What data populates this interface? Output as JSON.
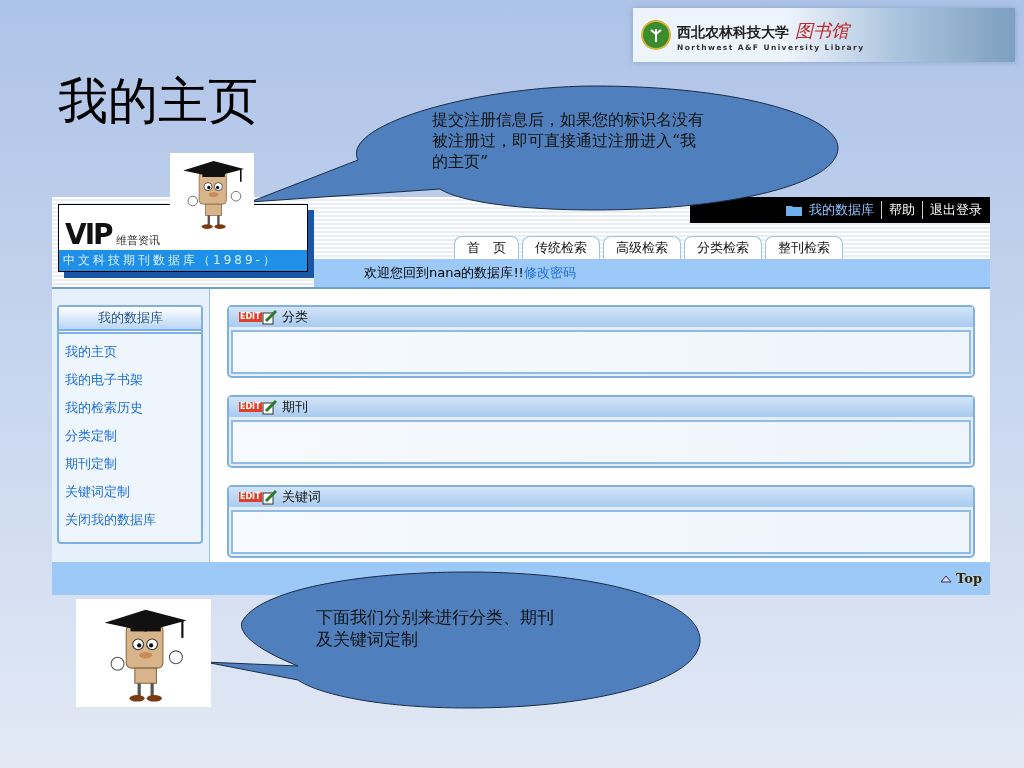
{
  "banner": {
    "name": "西北农林科技大学",
    "script_name": "图书馆",
    "subtitle": "Northwest A&F University Library"
  },
  "title": "我的主页",
  "site": {
    "logo_mark": "VIP",
    "logo_brand": "维普资讯",
    "logo_caption": "中文科技期刊数据库（1989-）",
    "top_links": [
      "我的数据库",
      "帮助",
      "退出登录"
    ],
    "tabs": [
      {
        "label": "首　页",
        "selected": false
      },
      {
        "label": "传统检索",
        "selected": false
      },
      {
        "label": "高级检索",
        "selected": false
      },
      {
        "label": "分类检索",
        "selected": false
      },
      {
        "label": "整刊检索",
        "selected": false
      }
    ],
    "welcome": "欢迎您回到nana的数据库!!",
    "welcome_link": "修改密码",
    "sidebar": {
      "title": "我的数据库",
      "items": [
        "我的主页",
        "我的电子书架",
        "我的检索历史",
        "分类定制",
        "期刊定制",
        "关键词定制",
        "关闭我的数据库"
      ]
    },
    "sections": [
      {
        "badge": "EDIT",
        "title": "分类"
      },
      {
        "badge": "EDIT",
        "title": "期刊"
      },
      {
        "badge": "EDIT",
        "title": "关键词"
      }
    ],
    "footer_link": "Top"
  },
  "callouts": [
    {
      "text": "提交注册信息后，如果您的标识名没有被注册过，即可直接通过注册进入“我的主页”"
    },
    {
      "text": "下面我们分别来进行分类、期刊及关键词定制"
    }
  ]
}
